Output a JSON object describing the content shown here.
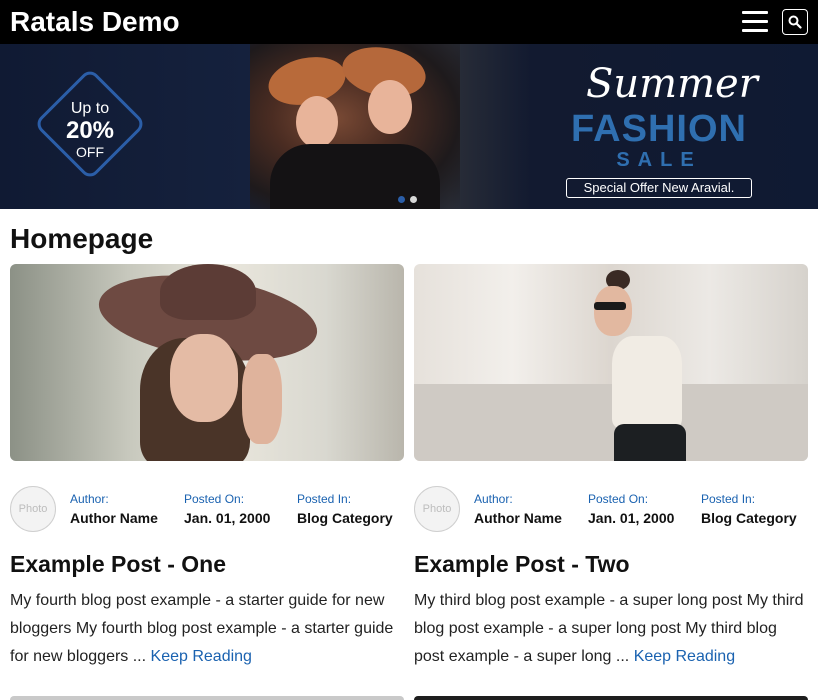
{
  "header": {
    "brand": "Ratals Demo"
  },
  "hero": {
    "badge_up": "Up to",
    "badge_percent": "20%",
    "badge_off": "OFF",
    "script_title": "Summer",
    "title": "FASHION",
    "subtitle": "SALE",
    "offer": "Special Offer New Aravial.",
    "slides": 2,
    "active_slide": 1
  },
  "page": {
    "title": "Homepage"
  },
  "labels": {
    "photo": "Photo",
    "author": "Author:",
    "posted_on": "Posted On:",
    "posted_in": "Posted In:"
  },
  "posts": [
    {
      "author": "Author Name",
      "date": "Jan. 01, 2000",
      "category": "Blog Category",
      "title": "Example Post - One",
      "excerpt": "My fourth blog post example - a starter guide for new bloggers My fourth blog post example - a starter guide for new bloggers ...",
      "read_more": "Keep Reading"
    },
    {
      "author": "Author Name",
      "date": "Jan. 01, 2000",
      "category": "Blog Category",
      "title": "Example Post - Two",
      "excerpt": "My third blog post example - a super long post My third blog post example - a super long post My third blog post example - a super long ...",
      "read_more": "Keep Reading"
    }
  ],
  "colors": {
    "accent": "#1a62b0",
    "header_bg": "#000000",
    "hero_blue": "#2f6fb0"
  }
}
